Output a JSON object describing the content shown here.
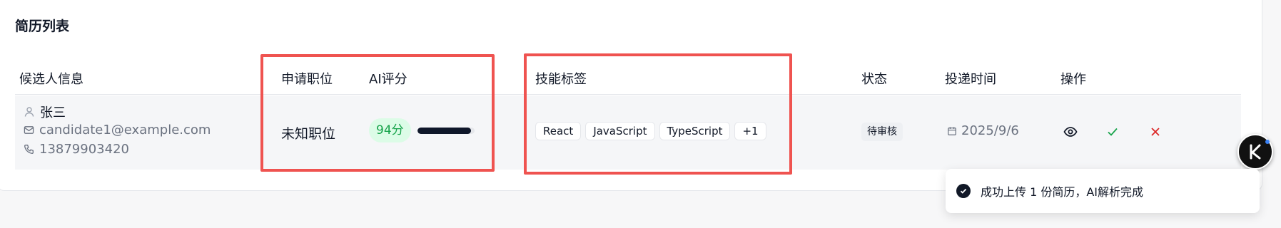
{
  "page": {
    "title": "简历列表"
  },
  "table": {
    "headers": {
      "candidate": "候选人信息",
      "position": "申请职位",
      "ai_score": "AI评分",
      "skills": "技能标签",
      "status": "状态",
      "date": "投递时间",
      "actions": "操作"
    },
    "rows": [
      {
        "name": "张三",
        "email": "candidate1@example.com",
        "phone": "13879903420",
        "position": "未知职位",
        "score_label": "94分",
        "score_percent": 94,
        "skills": [
          "React",
          "JavaScript",
          "TypeScript",
          "+1"
        ],
        "status": "待审核",
        "date": "2025/9/6"
      }
    ]
  },
  "icons": {
    "user": "user-icon",
    "mail": "mail-icon",
    "phone": "phone-icon",
    "calendar": "calendar-icon",
    "view": "eye-icon",
    "approve": "check-icon",
    "reject": "close-icon",
    "toast": "check-circle-icon"
  },
  "colors": {
    "highlight_box": "#ef5350",
    "score_badge_bg": "#dcfce7",
    "score_text": "#16a34a",
    "approve": "#16a34a",
    "reject": "#dc2626"
  },
  "toast": {
    "message": "成功上传 1 份简历，AI解析完成"
  }
}
